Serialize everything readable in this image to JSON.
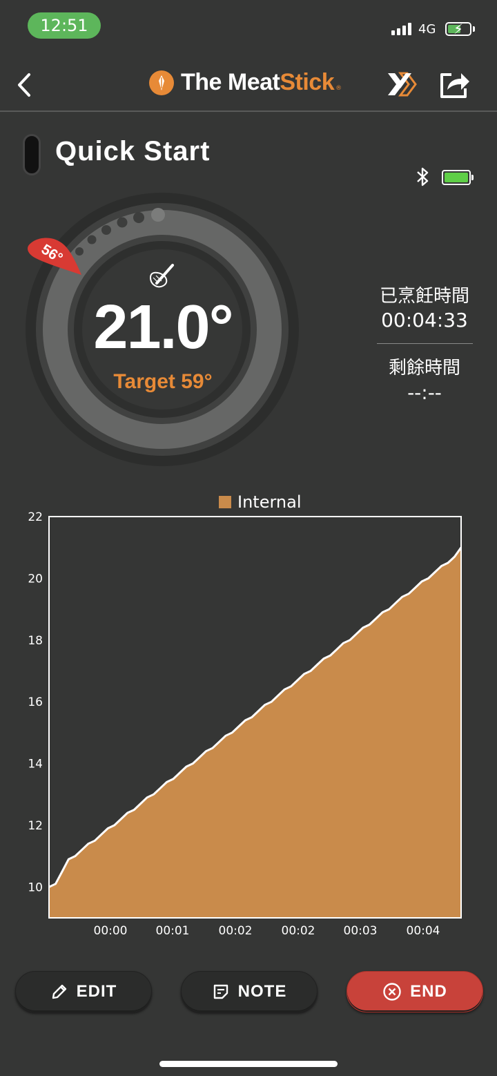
{
  "status_bar": {
    "time": "12:51",
    "network": "4G"
  },
  "nav": {
    "brand_prefix": "The Meat",
    "brand_suffix": "Stick",
    "brand_tm": "®"
  },
  "page": {
    "title": "Quick Start"
  },
  "gauge": {
    "current_temp": "21.0°",
    "target_label": "Target 59°",
    "marker_label": "56°",
    "accent_color": "#e78a37",
    "marker_color": "#d83a33"
  },
  "timers": {
    "cooked_label": "已烹飪時間",
    "cooked_value": "00:04:33",
    "remaining_label": "剩餘時間",
    "remaining_value": "--:--"
  },
  "chart_data": {
    "type": "area",
    "legend": [
      "Internal"
    ],
    "series": [
      {
        "name": "Internal",
        "color": "#c98b4b",
        "values": [
          10.0,
          10.1,
          10.5,
          10.9,
          11.0,
          11.2,
          11.4,
          11.5,
          11.7,
          11.9,
          12.0,
          12.2,
          12.4,
          12.5,
          12.7,
          12.9,
          13.0,
          13.2,
          13.4,
          13.5,
          13.7,
          13.9,
          14.0,
          14.2,
          14.4,
          14.5,
          14.7,
          14.9,
          15.0,
          15.2,
          15.4,
          15.5,
          15.7,
          15.9,
          16.0,
          16.2,
          16.4,
          16.5,
          16.7,
          16.9,
          17.0,
          17.2,
          17.4,
          17.5,
          17.7,
          17.9,
          18.0,
          18.2,
          18.4,
          18.5,
          18.7,
          18.9,
          19.0,
          19.2,
          19.4,
          19.5,
          19.7,
          19.9,
          20.0,
          20.2,
          20.4,
          20.5,
          20.7,
          21.0
        ]
      }
    ],
    "x_ticks": [
      "00:00",
      "00:01",
      "00:02",
      "00:02",
      "00:03",
      "00:04"
    ],
    "y_ticks": [
      "10",
      "12",
      "14",
      "16",
      "18",
      "20",
      "22"
    ],
    "ylim": [
      9.0,
      22
    ],
    "grid": false
  },
  "buttons": {
    "edit": "EDIT",
    "note": "NOTE",
    "end": "END"
  }
}
